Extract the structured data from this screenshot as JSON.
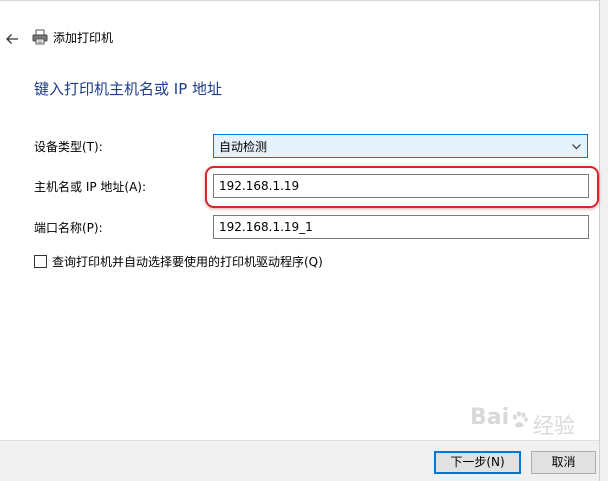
{
  "window": {
    "title": "添加打印机",
    "back_icon": "back-arrow-icon",
    "printer_icon": "printer-icon"
  },
  "page": {
    "heading": "键入打印机主机名或 IP 地址"
  },
  "form": {
    "device_type": {
      "label": "设备类型(T):",
      "value": "自动检测"
    },
    "hostname": {
      "label": "主机名或 IP 地址(A):",
      "value": "192.168.1.19"
    },
    "port_name": {
      "label": "端口名称(P):",
      "value": "192.168.1.19_1"
    },
    "query_printer": {
      "label": "查询打印机并自动选择要使用的打印机驱动程序(Q)",
      "checked": false
    }
  },
  "footer": {
    "next_label": "下一步(N)",
    "cancel_label": "取消"
  },
  "watermark": {
    "text": "Bai",
    "text2": "经验"
  },
  "colors": {
    "heading": "#1e3e8c",
    "select_border": "#0078d7",
    "select_bg": "#e5f1fb",
    "highlight": "#d6252b"
  }
}
